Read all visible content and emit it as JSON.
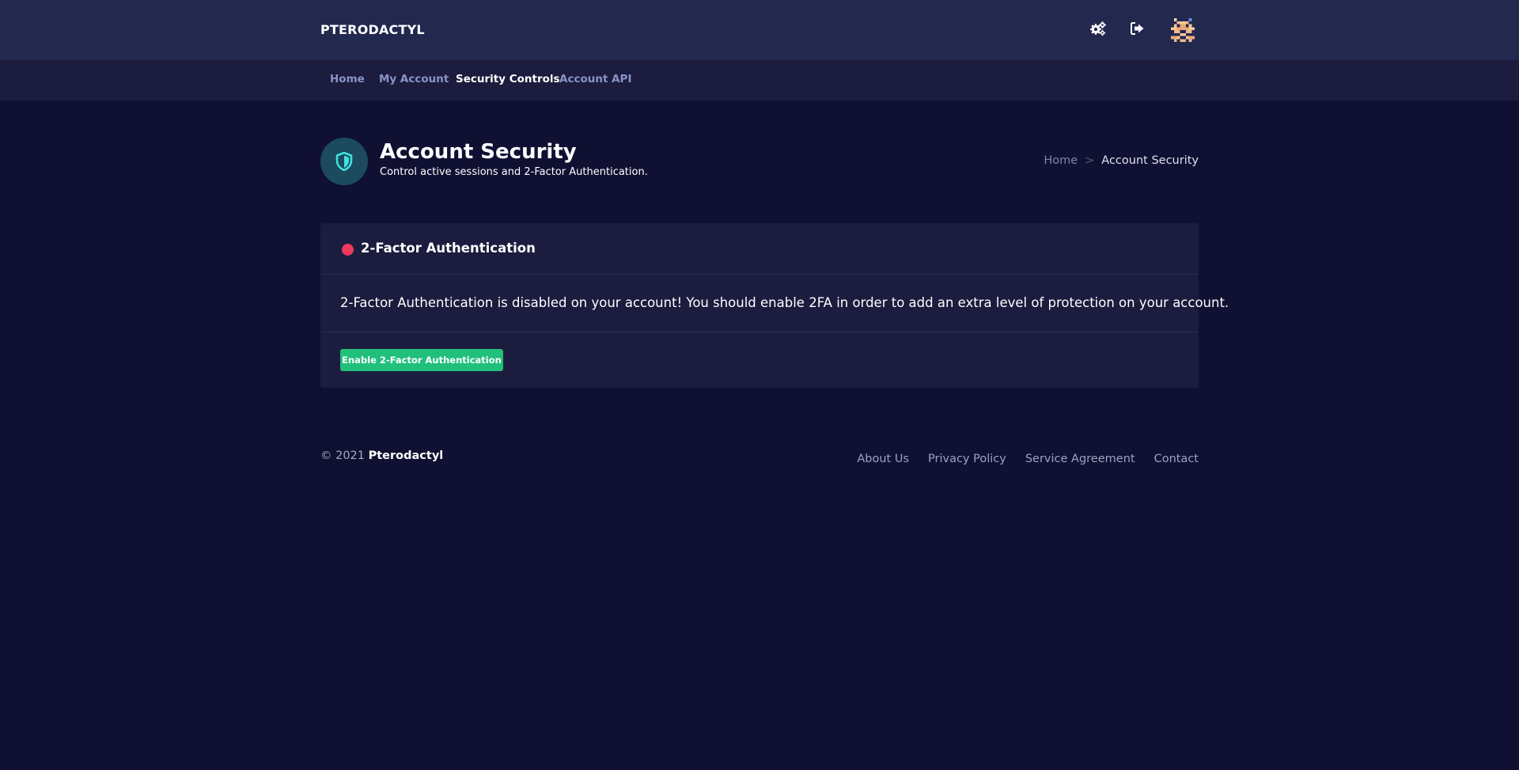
{
  "app": {
    "brand": "PTERODACTYL"
  },
  "topbar": {
    "icons": [
      "settings-gears-icon",
      "logout-icon"
    ],
    "avatar": "user-avatar"
  },
  "subnav": {
    "items": [
      {
        "label": "Home",
        "active": false
      },
      {
        "label": "My Account",
        "active": false
      },
      {
        "label": "Security Controls",
        "active": true
      },
      {
        "label": "Account API",
        "active": false
      }
    ]
  },
  "page": {
    "icon": "shield-icon",
    "title": "Account Security",
    "subtitle": "Control active sessions and 2-Factor Authentication.",
    "breadcrumb": {
      "home": "Home",
      "separator": ">",
      "current": "Account Security"
    }
  },
  "card": {
    "title": "2-Factor Authentication",
    "status_color": "#ee3a5d",
    "message": "2-Factor Authentication is disabled on your account! You should enable 2FA in order to add an extra level of protection on your account.",
    "button_label": "Enable 2-Factor Authentication",
    "button_color": "#21c07a"
  },
  "footer": {
    "copyright_prefix": "© 2021",
    "copyright_brand": "Pterodactyl",
    "links": [
      "About Us",
      "Privacy Policy",
      "Service Agreement",
      "Contact"
    ]
  },
  "colors": {
    "background": "#0f1032",
    "topbar": "#23284f",
    "subnav": "#1b1c3e",
    "card": "#1b1c3e",
    "accent_teal": "#3fe0e0"
  }
}
